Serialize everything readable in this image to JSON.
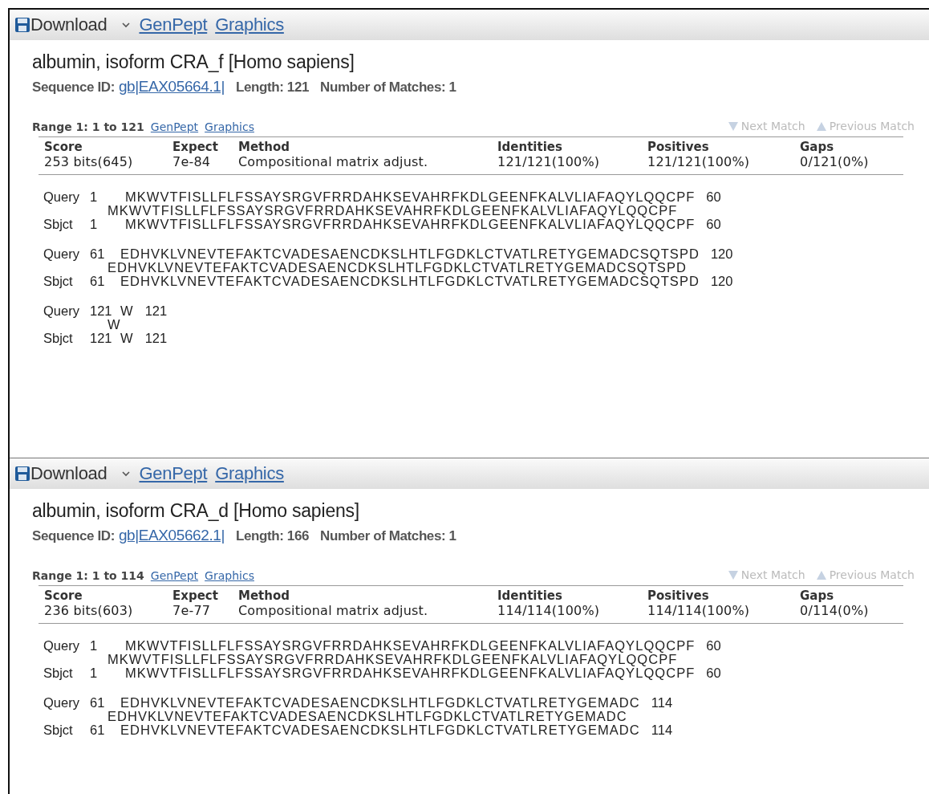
{
  "hits": [
    {
      "toolbar": {
        "download": "Download",
        "links": [
          "GenPept",
          "Graphics"
        ]
      },
      "title": "albumin, isoform CRA_f [Homo sapiens]",
      "sequence_id_label": "Sequence ID:",
      "sequence_id": "gb|EAX05664.1|",
      "length": "Length: 121",
      "matches": "Number of Matches: 1",
      "range": {
        "label": "Range 1: 1 to 121",
        "links": [
          "GenPept",
          "Graphics"
        ],
        "next": {
          "label": "Next Match",
          "disabled": true
        },
        "previous": {
          "label": "Previous Match",
          "disabled": true
        }
      },
      "table": {
        "columns": [
          "Score",
          "Expect",
          "Method",
          "Identities",
          "Positives",
          "Gaps"
        ],
        "row": [
          "253 bits(645)",
          "7e-84",
          "Compositional matrix adjust.",
          "121/121(100%)",
          "121/121(100%)",
          "0/121(0%)"
        ]
      },
      "alignment": [
        {
          "query": {
            "label": "Query",
            "start": "1",
            "seq": "MKWVTFISLLFLFSSAYSRGVFRRDAHKSEVAHRFKDLGEENFKALVLIAFAQYLQQCPF",
            "end": "60"
          },
          "midline": "MKWVTFISLLFLFSSAYSRGVFRRDAHKSEVAHRFKDLGEENFKALVLIAFAQYLQQCPF",
          "sbjct": {
            "label": "Sbjct",
            "start": "1",
            "seq": "MKWVTFISLLFLFSSAYSRGVFRRDAHKSEVAHRFKDLGEENFKALVLIAFAQYLQQCPF",
            "end": "60"
          }
        },
        {
          "query": {
            "label": "Query",
            "start": "61",
            "seq": "EDHVKLVNEVTEFAKTCVADESAENCDKSLHTLFGDKLCTVATLRETYGEMADCSQTSPD",
            "end": "120"
          },
          "midline": "EDHVKLVNEVTEFAKTCVADESAENCDKSLHTLFGDKLCTVATLRETYGEMADCSQTSPD",
          "sbjct": {
            "label": "Sbjct",
            "start": "61",
            "seq": "EDHVKLVNEVTEFAKTCVADESAENCDKSLHTLFGDKLCTVATLRETYGEMADCSQTSPD",
            "end": "120"
          }
        },
        {
          "query": {
            "label": "Query",
            "start": "121",
            "seq": "W",
            "end": "121"
          },
          "midline": "W",
          "sbjct": {
            "label": "Sbjct",
            "start": "121",
            "seq": "W",
            "end": "121"
          }
        }
      ]
    },
    {
      "toolbar": {
        "download": "Download",
        "links": [
          "GenPept",
          "Graphics"
        ]
      },
      "title": "albumin, isoform CRA_d [Homo sapiens]",
      "sequence_id_label": "Sequence ID:",
      "sequence_id": "gb|EAX05662.1|",
      "length": "Length: 166",
      "matches": "Number of Matches: 1",
      "range": {
        "label": "Range 1: 1 to 114",
        "links": [
          "GenPept",
          "Graphics"
        ],
        "next": {
          "label": "Next Match",
          "disabled": true
        },
        "previous": {
          "label": "Previous Match",
          "disabled": true
        }
      },
      "table": {
        "columns": [
          "Score",
          "Expect",
          "Method",
          "Identities",
          "Positives",
          "Gaps"
        ],
        "row": [
          "236 bits(603)",
          "7e-77",
          "Compositional matrix adjust.",
          "114/114(100%)",
          "114/114(100%)",
          "0/114(0%)"
        ]
      },
      "alignment": [
        {
          "query": {
            "label": "Query",
            "start": "1",
            "seq": "MKWVTFISLLFLFSSAYSRGVFRRDAHKSEVAHRFKDLGEENFKALVLIAFAQYLQQCPF",
            "end": "60"
          },
          "midline": "MKWVTFISLLFLFSSAYSRGVFRRDAHKSEVAHRFKDLGEENFKALVLIAFAQYLQQCPF",
          "sbjct": {
            "label": "Sbjct",
            "start": "1",
            "seq": "MKWVTFISLLFLFSSAYSRGVFRRDAHKSEVAHRFKDLGEENFKALVLIAFAQYLQQCPF",
            "end": "60"
          }
        },
        {
          "query": {
            "label": "Query",
            "start": "61",
            "seq": "EDHVKLVNEVTEFAKTCVADESAENCDKSLHTLFGDKLCTVATLRETYGEMADC",
            "end": "114"
          },
          "midline": "EDHVKLVNEVTEFAKTCVADESAENCDKSLHTLFGDKLCTVATLRETYGEMADC",
          "sbjct": {
            "label": "Sbjct",
            "start": "61",
            "seq": "EDHVKLVNEVTEFAKTCVADESAENCDKSLHTLFGDKLCTVATLRETYGEMADC",
            "end": "114"
          }
        }
      ]
    }
  ]
}
